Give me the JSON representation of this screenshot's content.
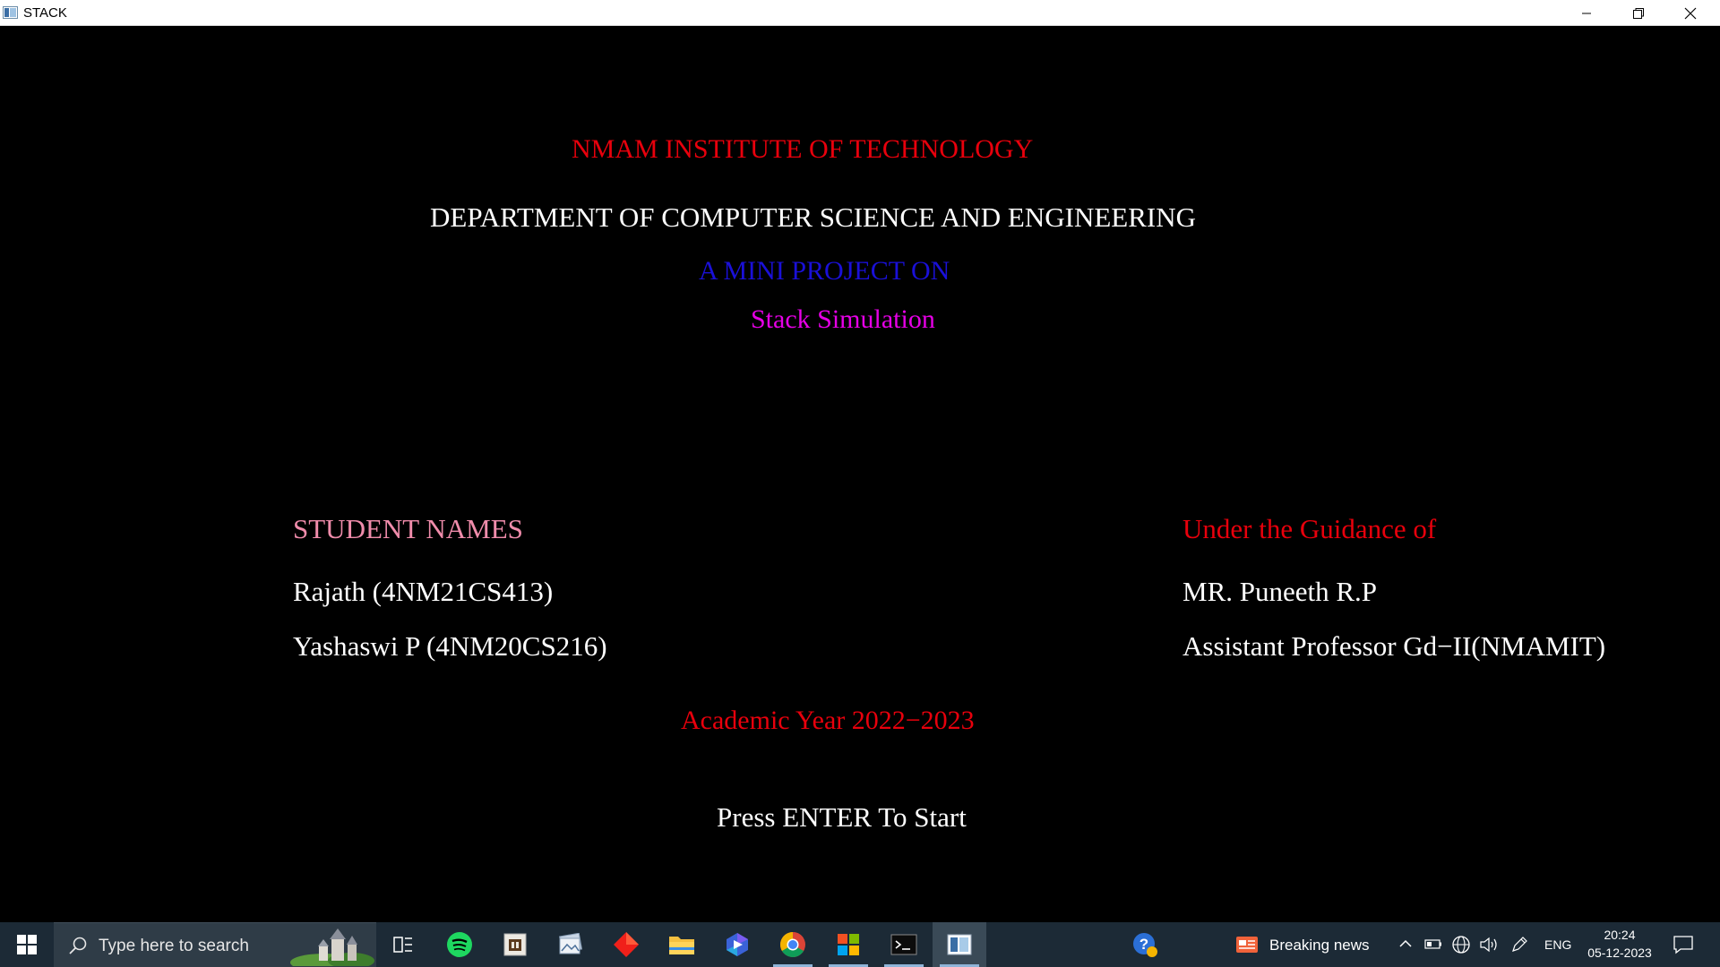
{
  "window": {
    "title": "STACK",
    "controls": [
      "minimize-icon",
      "restore-icon",
      "close-icon"
    ]
  },
  "screen": {
    "institute": "NMAM INSTITUTE OF TECHNOLOGY",
    "department": "DEPARTMENT OF COMPUTER SCIENCE AND ENGINEERING",
    "project_heading": "A MINI PROJECT ON",
    "project_title": "Stack Simulation",
    "students_heading": "STUDENT NAMES",
    "students": [
      "Rajath (4NM21CS413)",
      "Yashaswi P (4NM20CS216)"
    ],
    "guidance_heading": "Under the Guidance of",
    "guide_name": "MR. Puneeth R.P",
    "guide_title": "Assistant Professor Gd−II(NMAMIT)",
    "academic_year": "Academic Year 2022−2023",
    "prompt": "Press ENTER To Start"
  },
  "colors": {
    "red": "#e8000c",
    "white": "#ffffff",
    "blue": "#1a10d8",
    "magenta": "#e600e6",
    "pink": "#f08cab",
    "background": "#000000",
    "taskbar": "#1c2a36"
  },
  "taskbar": {
    "start_icon": "windows-logo-icon",
    "search_placeholder": "Type here to search",
    "apps": [
      {
        "icon": "task-view-icon",
        "active": false
      },
      {
        "icon": "spotify-icon",
        "active": false
      },
      {
        "icon": "app-icon",
        "active": false
      },
      {
        "icon": "photos-icon",
        "active": false
      },
      {
        "icon": "red-diamond-app-icon",
        "active": false
      },
      {
        "icon": "file-explorer-icon",
        "active": false
      },
      {
        "icon": "copilot-icon",
        "active": false
      },
      {
        "icon": "chrome-icon",
        "active": false
      },
      {
        "icon": "microsoft-store-icon",
        "active": false
      },
      {
        "icon": "terminal-icon",
        "active": false
      },
      {
        "icon": "stack-app-icon",
        "active": true
      }
    ],
    "news": "Breaking news",
    "language": "ENG",
    "time": "20:24",
    "date": "05-12-2023"
  }
}
